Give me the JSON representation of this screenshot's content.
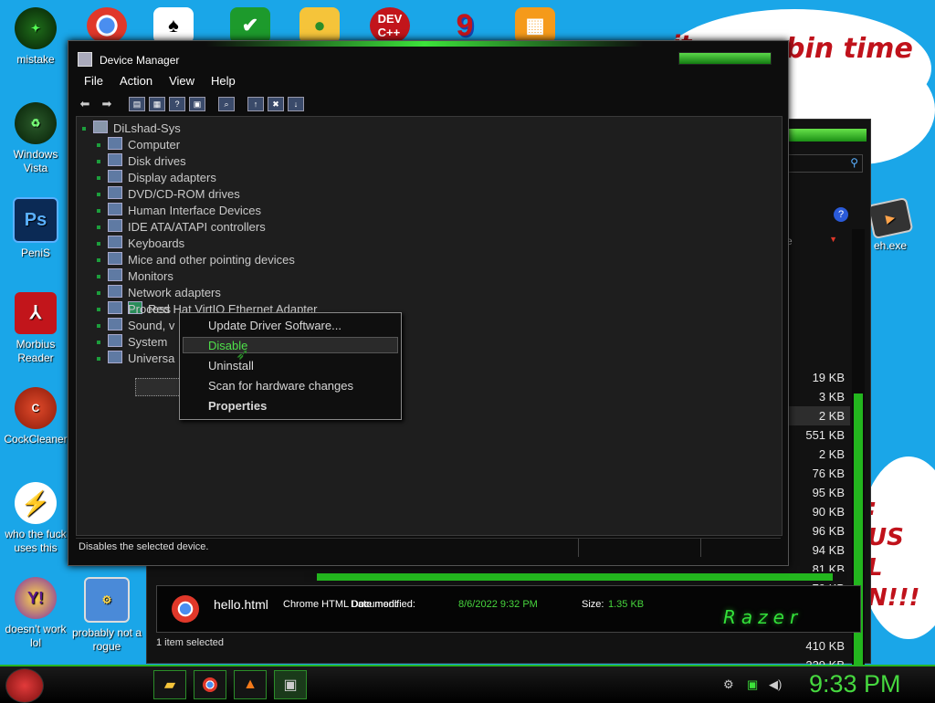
{
  "desktop": {
    "banner_left": "it",
    "banner_right": "bin  time",
    "side_text": [
      ":",
      "US",
      "L",
      "N!!!"
    ],
    "icons": [
      {
        "label": "mistake",
        "icon": "green-gear-icon"
      },
      {
        "label": "Windows Vista",
        "icon": "recycle-bin-icon"
      },
      {
        "label": "PeniS",
        "icon": "photoshop-icon"
      },
      {
        "label": "Morbius Reader",
        "icon": "pdf-reader-icon"
      },
      {
        "label": "CockCleaner",
        "icon": "ccleaner-icon"
      },
      {
        "label": "who the fuck uses this",
        "icon": "lightning-icon"
      },
      {
        "label": "doesn't work lol",
        "icon": "yahoo-messenger-icon"
      },
      {
        "label": "probably not a rogue",
        "icon": "monitor-gears-icon"
      },
      {
        "label": "eh.exe",
        "icon": "exe-icon"
      }
    ],
    "top_icons": [
      "chrome-icon",
      "solitaire-icon",
      "security-shield-icon",
      "angry-pig-icon",
      "devcpp-icon",
      "number-nine-icon",
      "puzzle-icon"
    ]
  },
  "explorer": {
    "sizes": [
      "19 KB",
      "3 KB",
      "2 KB",
      "551 KB",
      "2 KB",
      "76 KB",
      "95 KB",
      "90 KB",
      "96 KB",
      "94 KB",
      "81 KB",
      "79 KB",
      "75 KB",
      "95 KB",
      "410 KB",
      "229 KB",
      "7 KB"
    ],
    "header_fragment": "e",
    "file_name": "hello.html",
    "file_type": "Chrome HTML Document",
    "date_label": "Date modified:",
    "date_value": "8/6/2022 9:32 PM",
    "size_label": "Size:",
    "size_value": "1.35 KB",
    "brand": "Razer",
    "status": "1 item selected"
  },
  "device_manager": {
    "title": "Device Manager",
    "menu": [
      "File",
      "Action",
      "View",
      "Help"
    ],
    "root": "DiLshad-Sys",
    "tree": [
      "Computer",
      "Disk drives",
      "Display adapters",
      "DVD/CD-ROM drives",
      "Human Interface Devices",
      "IDE ATA/ATAPI controllers",
      "Keyboards",
      "Mice and other pointing devices",
      "Monitors",
      "Network adapters",
      "Red Hat VirtIO Ethernet Adapter",
      "Process",
      "Sound, v",
      "System",
      "Universa"
    ],
    "status": "Disables the selected device."
  },
  "context_menu": {
    "items": [
      "Update Driver Software...",
      "Disable",
      "Uninstall",
      "Scan for hardware changes",
      "Properties"
    ],
    "highlighted": "Disable",
    "highlight_color": "#4ee04a"
  },
  "taskbar": {
    "clock": "9:33 PM",
    "apps": [
      "file-explorer-icon",
      "chrome-icon",
      "vlc-icon",
      "device-manager-icon"
    ],
    "tray": [
      "network-icon",
      "monitor-icon",
      "speaker-icon"
    ]
  }
}
